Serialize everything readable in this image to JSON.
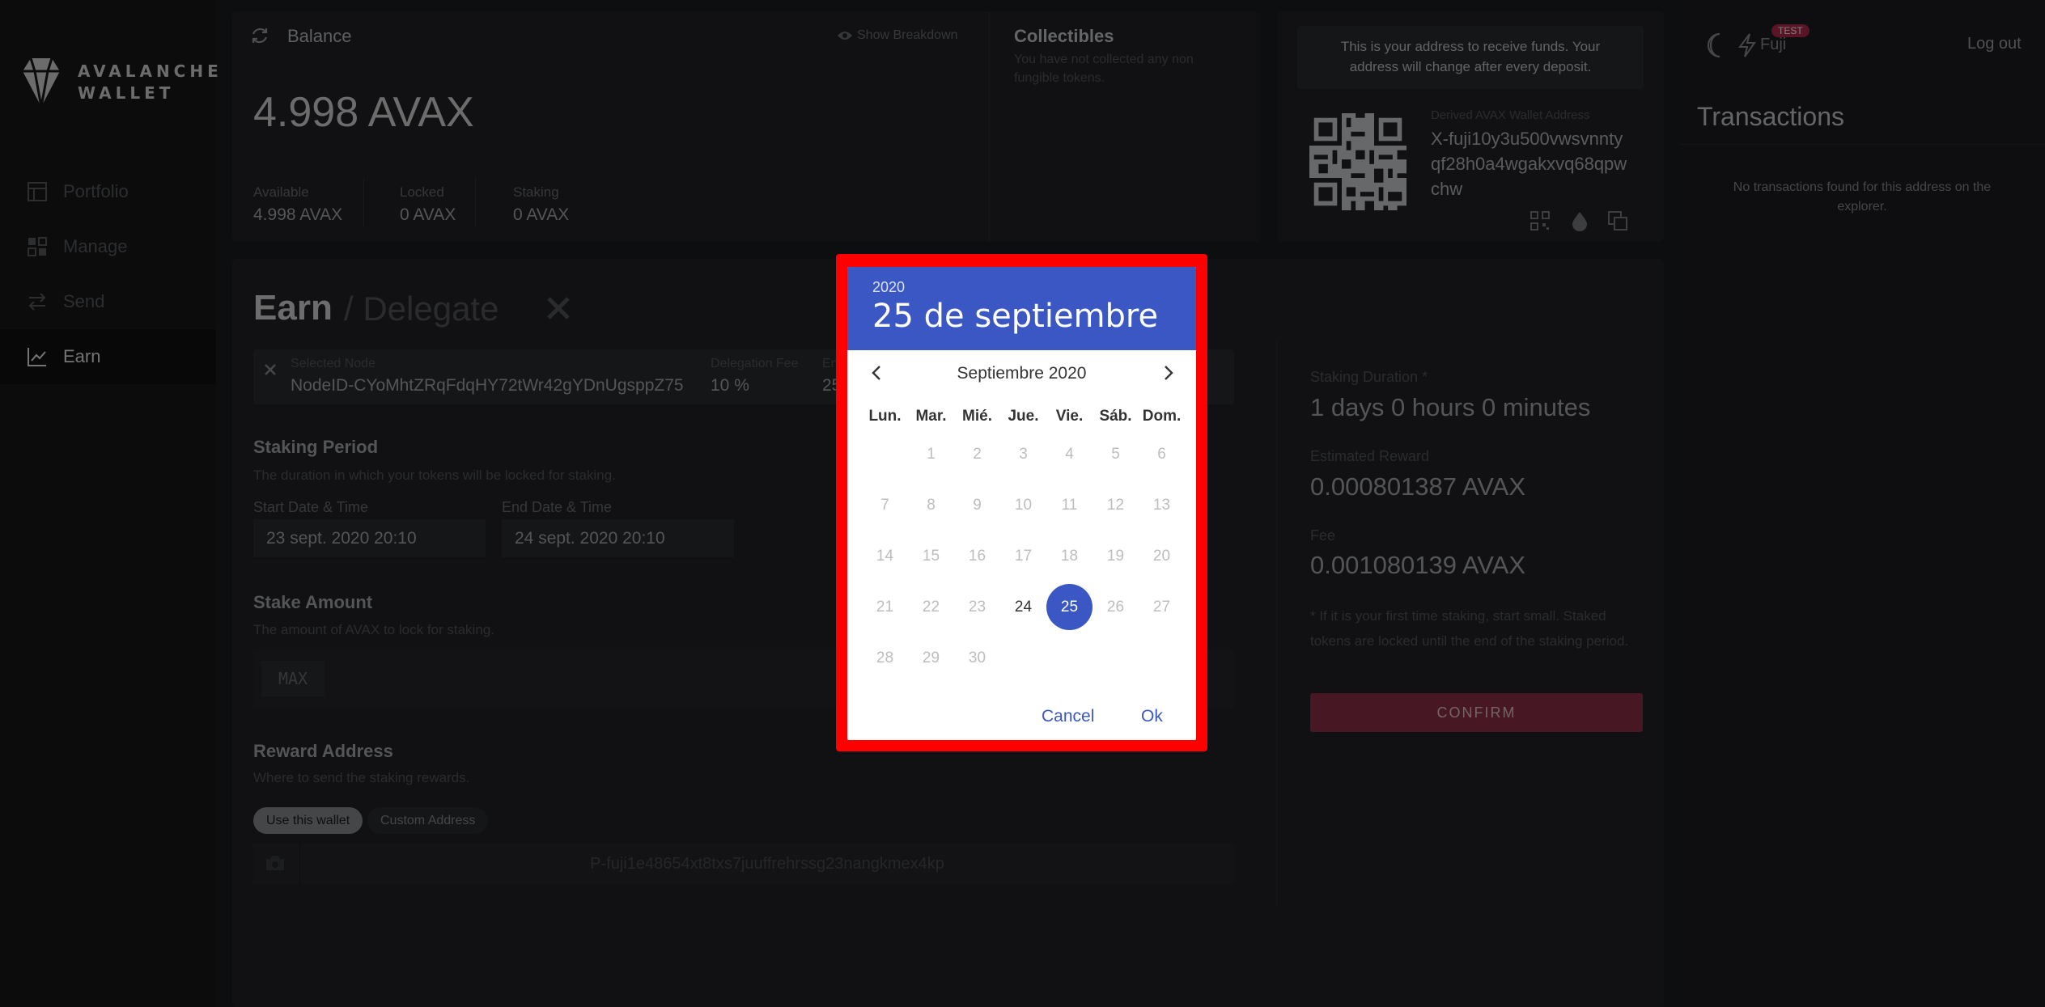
{
  "sidebar": {
    "logo_line1": "AVALANCHE",
    "logo_line2": "WALLET",
    "items": [
      {
        "label": "Portfolio",
        "icon": "portfolio-icon"
      },
      {
        "label": "Manage",
        "icon": "manage-icon"
      },
      {
        "label": "Send",
        "icon": "send-icon"
      },
      {
        "label": "Earn",
        "icon": "earn-icon",
        "active": true
      }
    ]
  },
  "balance": {
    "title": "Balance",
    "show_breakdown": "Show Breakdown",
    "amount": "4.998 AVAX",
    "stats": [
      {
        "label": "Available",
        "value": "4.998 AVAX"
      },
      {
        "label": "Locked",
        "value": "0 AVAX"
      },
      {
        "label": "Staking",
        "value": "0 AVAX"
      }
    ]
  },
  "collectibles": {
    "title": "Collectibles",
    "empty": "You have not collected any non fungible tokens."
  },
  "address": {
    "notice": "This is your address to receive funds. Your address will change after every deposit.",
    "label": "Derived AVAX Wallet Address",
    "value_lines": [
      "X-fuji10y3u500vwsvnnty",
      "qf28h0a4wgakxvq68qpw",
      "chw"
    ]
  },
  "header": {
    "network_badge": "TEST",
    "network": "Fuji",
    "logout": "Log out"
  },
  "transactions": {
    "title": "Transactions",
    "empty": "No transactions found for this address on the explorer."
  },
  "earn": {
    "title": "Earn",
    "subtitle": "/ Delegate",
    "selected_node_label": "Selected Node",
    "node_id": "NodeID-CYoMhtZRqFdqHY72tWr42gYDnUgsppZ75",
    "delegation_fee_label": "Delegation Fee",
    "delegation_fee": "10 %",
    "end_label_partial": "En",
    "end_value_partial": "25",
    "staking_period_title": "Staking Period",
    "staking_period_desc": "The duration in which your tokens will be locked for staking.",
    "start_label": "Start Date & Time",
    "start_value": "23 sept. 2020 20:10",
    "end_label": "End Date & Time",
    "end_value": "24 sept. 2020 20:10",
    "stake_amount_title": "Stake Amount",
    "stake_amount_desc": "The amount of AVAX to lock for staking.",
    "max": "MAX",
    "reward_title": "Reward Address",
    "reward_desc": "Where to send the staking rewards.",
    "use_wallet": "Use this wallet",
    "custom_address": "Custom Address",
    "reward_address": "P-fuji1e48654xt8txs7juuffrehrssg23nangkmex4kp"
  },
  "summary": {
    "duration_label": "Staking Duration *",
    "duration_value": "1 days 0 hours 0 minutes",
    "reward_label": "Estimated Reward",
    "reward_value": "0.000801387 AVAX",
    "fee_label": "Fee",
    "fee_value": "0.001080139 AVAX",
    "note": "* If it is your first time staking, start small. Staked tokens are locked until the end of the staking period.",
    "confirm": "CONFIRM"
  },
  "datepicker": {
    "year": "2020",
    "selected_date": "25 de septiembre",
    "month_label": "Septiembre 2020",
    "weekdays": [
      "Lun.",
      "Mar.",
      "Mié.",
      "Jue.",
      "Vie.",
      "Sáb.",
      "Dom."
    ],
    "weeks": [
      [
        "",
        "1",
        "2",
        "3",
        "4",
        "5",
        "6"
      ],
      [
        "7",
        "8",
        "9",
        "10",
        "11",
        "12",
        "13"
      ],
      [
        "14",
        "15",
        "16",
        "17",
        "18",
        "19",
        "20"
      ],
      [
        "21",
        "22",
        "23",
        "24",
        "25",
        "26",
        "27"
      ],
      [
        "28",
        "29",
        "30",
        "",
        "",
        "",
        ""
      ]
    ],
    "enabled_day": "24",
    "selected_day": "25",
    "cancel": "Cancel",
    "ok": "Ok",
    "accent": "#3a57c4"
  }
}
